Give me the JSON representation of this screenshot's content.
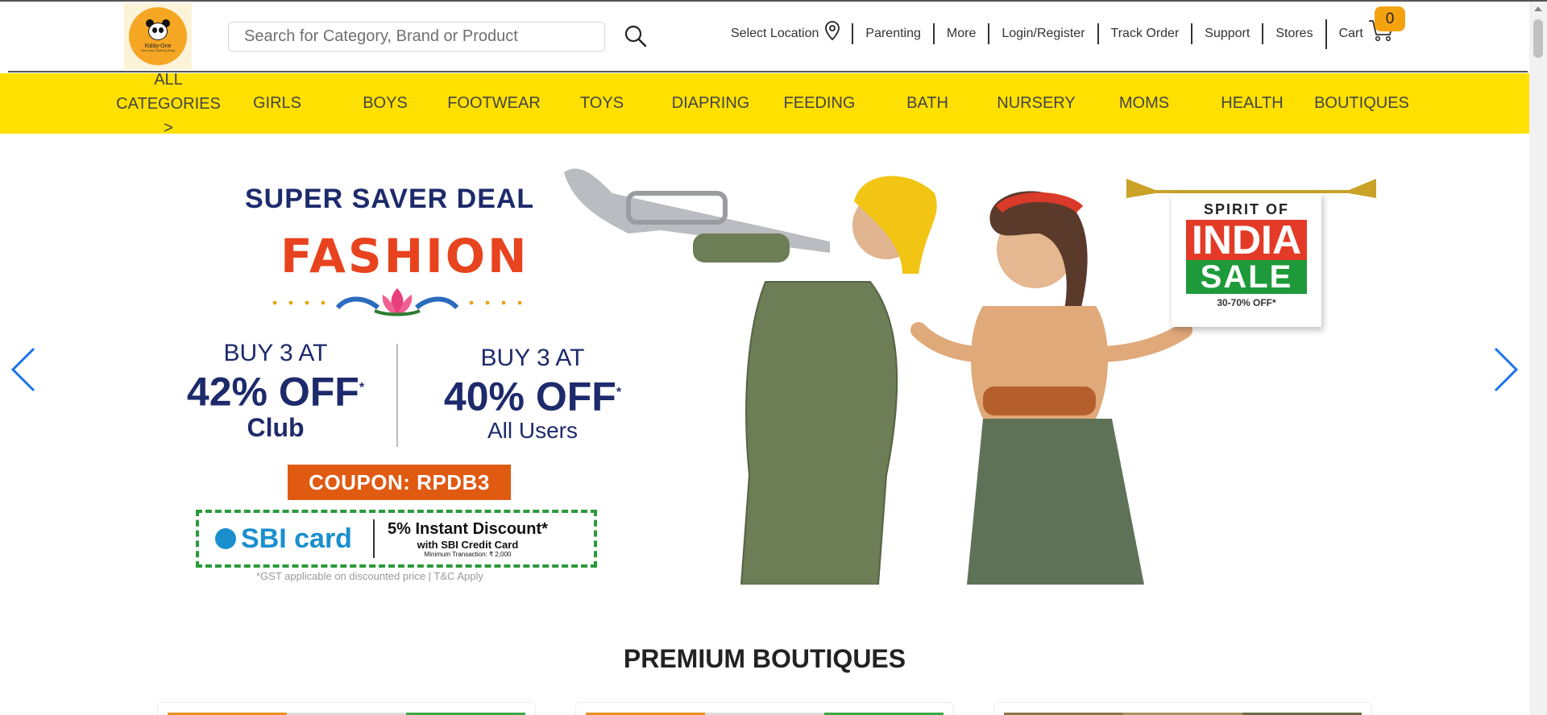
{
  "header": {
    "logo": {
      "name": "Kiddy-One",
      "tagline": "Your kids Clothing Shop"
    },
    "search": {
      "placeholder": "Search for Category, Brand or Product",
      "value": ""
    },
    "topnav": {
      "location": "Select Location",
      "parenting": "Parenting",
      "more": "More",
      "login": "Login/Register",
      "track": "Track Order",
      "support": "Support",
      "stores": "Stores",
      "cart": "Cart",
      "cart_count": "0"
    }
  },
  "categories": {
    "all_line1": "ALL",
    "all_line2": "CATEGORIES >",
    "items": [
      "GIRLS",
      "BOYS",
      "FOOTWEAR",
      "TOYS",
      "DIAPRING",
      "FEEDING",
      "BATH",
      "NURSERY",
      "MOMS",
      "HEALTH",
      "BOUTIQUES"
    ]
  },
  "banner": {
    "deal_title": "SUPER SAVER DEAL",
    "headline": "FASHION",
    "offer_club": {
      "buy": "BUY 3 AT",
      "pct": "42% OFF",
      "star": "*",
      "sub": "Club"
    },
    "offer_all": {
      "buy": "BUY 3 AT",
      "pct": "40% OFF",
      "star": "*",
      "sub": "All Users"
    },
    "coupon": "COUPON: RPDB3",
    "sbi": {
      "logo": "SBI card",
      "line1": "5% Instant Discount*",
      "line2": "with SBI Credit Card",
      "line3": "Minimum Transaction: ₹ 2,000"
    },
    "gst_note": "*GST applicable on discounted price | T&C Apply",
    "india": {
      "spirit": "SPIRIT OF",
      "india": "INDIA",
      "sale": "SALE",
      "off": "30-70% OFF*"
    }
  },
  "sections": {
    "boutiques_title": "PREMIUM BOUTIQUES"
  },
  "colors": {
    "brand_yellow": "#ffe000",
    "cart_badge": "#f5a20f",
    "arrow_blue": "#1a73e8",
    "coupon_orange": "#e05a12",
    "navy": "#1d2a6b"
  }
}
